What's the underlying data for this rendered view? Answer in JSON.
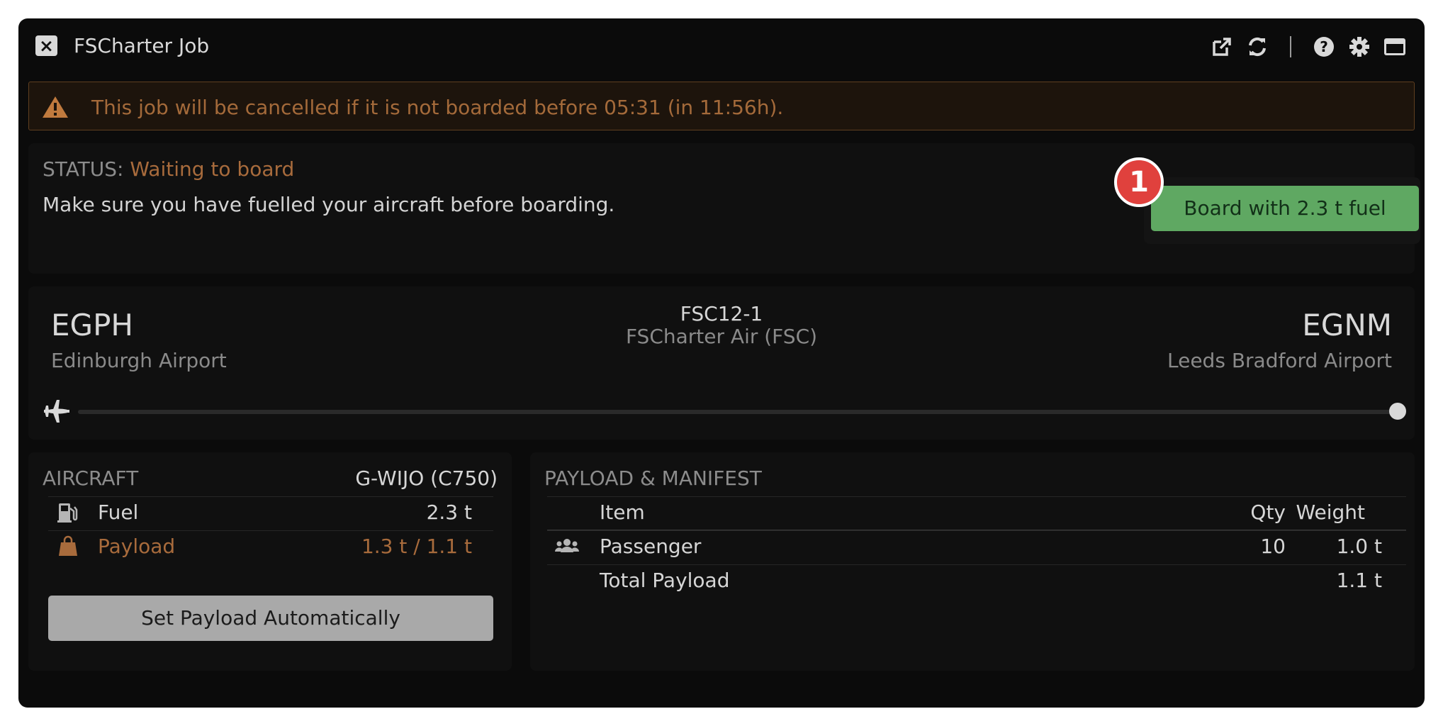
{
  "window": {
    "title": "FSCharter Job",
    "close_label": "×",
    "toolbar_icons": [
      "external-link-icon",
      "refresh-icon",
      "help-icon",
      "gear-icon",
      "panel-icon"
    ]
  },
  "warning": {
    "icon": "warning-triangle-icon",
    "text": "This job will be cancelled if it is not boarded before 05:31 (in 11:56h)."
  },
  "status": {
    "label": "STATUS:",
    "value": "Waiting to board",
    "note": "Make sure you have fuelled your aircraft before boarding.",
    "board_button": "Board with 2.3 t fuel",
    "badge": "1"
  },
  "route": {
    "departure": {
      "code": "EGPH",
      "name": "Edinburgh Airport"
    },
    "flight_number": "FSC12-1",
    "airline": "FSCharter Air (FSC)",
    "arrival": {
      "code": "EGNM",
      "name": "Leeds Bradford Airport"
    },
    "progress": 0
  },
  "aircraft": {
    "label": "AIRCRAFT",
    "registration": "G-WIJO (C750)",
    "rows": [
      {
        "icon": "fuel-pump-icon",
        "label": "Fuel",
        "value": "2.3 t"
      },
      {
        "icon": "bag-icon",
        "label": "Payload",
        "value": "1.3 t / 1.1 t"
      }
    ],
    "set_payload_button": "Set Payload Automatically"
  },
  "payload": {
    "label": "PAYLOAD & MANIFEST",
    "columns": {
      "item": "Item",
      "qty": "Qty",
      "weight": "Weight"
    },
    "rows": [
      {
        "icon": "users-icon",
        "item": "Passenger",
        "qty": "10",
        "weight": "1.0 t"
      }
    ],
    "total": {
      "item": "Total Payload",
      "weight": "1.1 t"
    }
  },
  "colors": {
    "background": "#0b0b0b",
    "warning_text": "#a46a3a",
    "status_value": "#a86b3c",
    "board_button": "#5fa862",
    "badge": "#e0413d"
  }
}
